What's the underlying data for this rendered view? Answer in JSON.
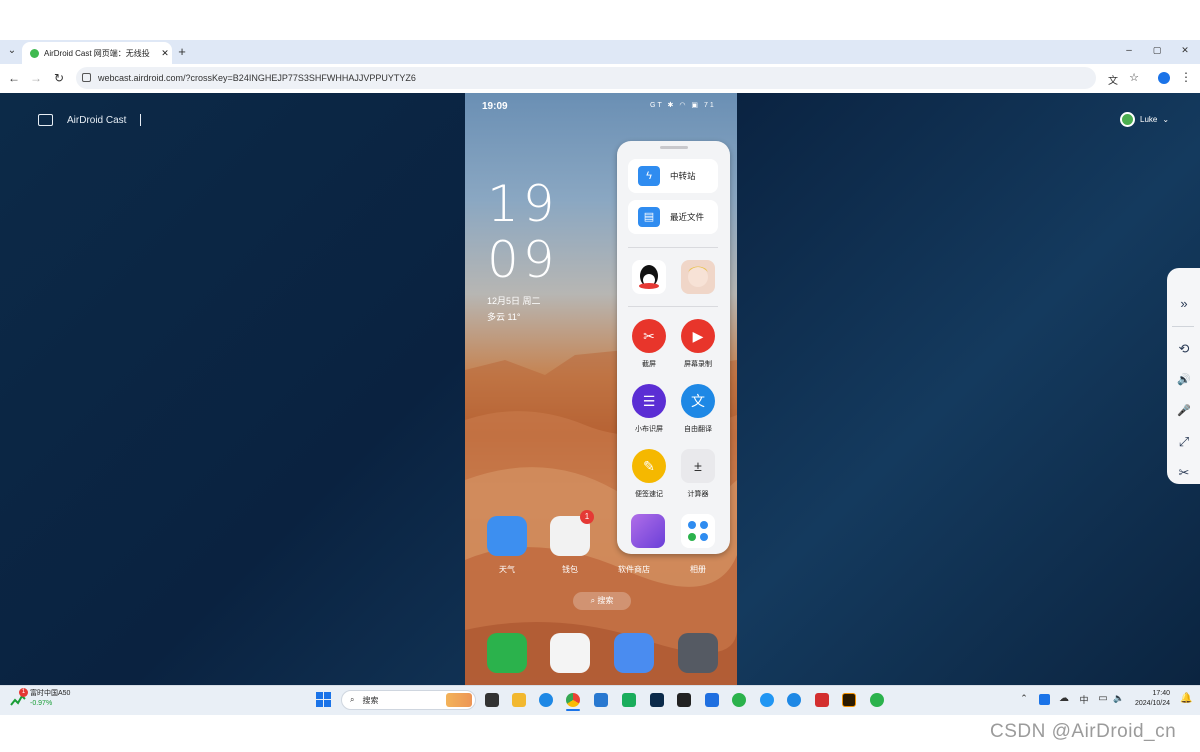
{
  "browser": {
    "tab_title": "AirDroid Cast 网页端：无线投",
    "tab_close": "✕",
    "new_tab": "+",
    "url": "webcast.airdroid.com/?crossKey=B24INGHEJP77S3SHFWHHAJJVPPUYTYZ6",
    "window_controls": [
      "–",
      "▢",
      "✕"
    ]
  },
  "page": {
    "brand": "AirDroid Cast",
    "user": "Luke"
  },
  "phone": {
    "status_time": "19:09",
    "status_icons": "GT ✱ ◠ ▣ 71",
    "clock_hour": "19",
    "clock_minute": "09",
    "date": "12月5日  周二",
    "weather": "多云  11°",
    "panel": {
      "cards": [
        "中转站",
        "最近文件"
      ],
      "tools": [
        {
          "label": "截屏",
          "color": "#e8352b",
          "glyph": "✂"
        },
        {
          "label": "屏幕录制",
          "color": "#e8352b",
          "glyph": "▶"
        },
        {
          "label": "小布识屏",
          "color": "#5b2ed4",
          "glyph": "☰"
        },
        {
          "label": "自由翻译",
          "color": "#1e88e5",
          "glyph": "文"
        },
        {
          "label": "便签速记",
          "color": "#f5b800",
          "glyph": "✎"
        },
        {
          "label": "计算器",
          "color": "#e9e9ec",
          "glyph": "±"
        }
      ]
    },
    "home_apps": [
      {
        "label": "天气",
        "color": "#3d8ff0"
      },
      {
        "label": "钱包",
        "color": "#f2f2f2",
        "badge": "1"
      },
      {
        "label": "软件商店",
        "color": "#19b27b"
      },
      {
        "label": "相册",
        "color": "#e8e8ee"
      }
    ],
    "search_label": "搜索",
    "dock_colors": [
      "#2bb24c",
      "#f4f4f4",
      "#4a8cf0",
      "#555a63"
    ]
  },
  "controls": [
    "»",
    "⟲",
    "🔊",
    "🎤",
    "⤢",
    "✂"
  ],
  "taskbar": {
    "stock_name": "富时中国A50",
    "stock_change": "-0.97%",
    "stock_badge": "1",
    "search_placeholder": "搜索",
    "tray_ime": "中",
    "time": "17:40",
    "date": "2024/10/24"
  },
  "watermark": "CSDN @AirDroid_cn"
}
